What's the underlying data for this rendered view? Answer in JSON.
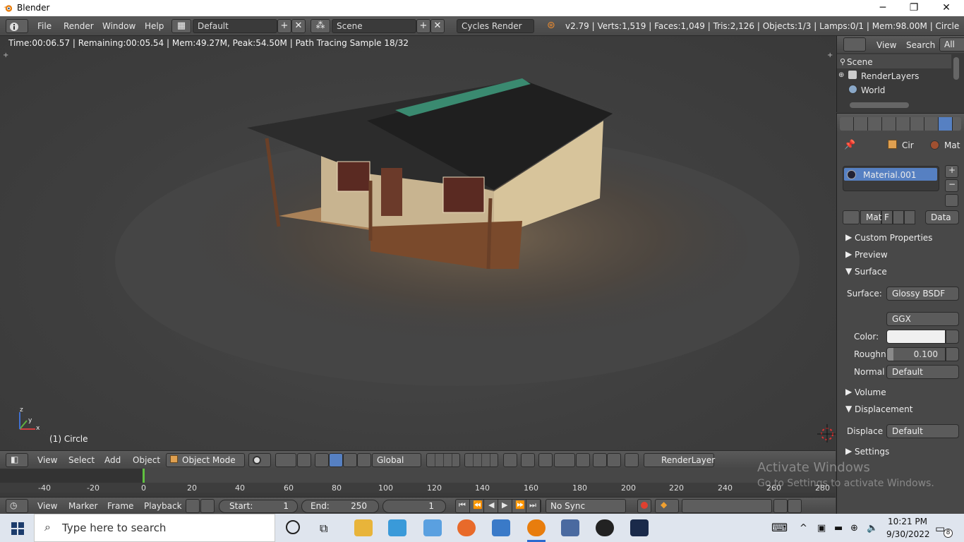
{
  "window": {
    "title": "Blender",
    "minimize": "─",
    "maximize": "❐",
    "close": "✕"
  },
  "info_header": {
    "menus": [
      "File",
      "Render",
      "Window",
      "Help"
    ],
    "screen_layout": "Default",
    "scene": "Scene",
    "render_engine": "Cycles Render",
    "stats": "v2.79 | Verts:1,519 | Faces:1,049 | Tris:2,126 | Objects:1/3 | Lamps:0/1 | Mem:98.00M | Circle"
  },
  "viewport": {
    "render_status": "Time:00:06.57 | Remaining:00:05.54 | Mem:49.27M, Peak:54.50M | Path Tracing Sample 18/32",
    "object_label": "(1) Circle",
    "axis": {
      "x": "x",
      "y": "y",
      "z": "z"
    },
    "header": {
      "menus": [
        "View",
        "Select",
        "Add",
        "Object"
      ],
      "mode": "Object Mode",
      "orientation": "Global",
      "render_layer": "RenderLayer"
    }
  },
  "timeline": {
    "ticks": [
      "-40",
      "-20",
      "0",
      "20",
      "40",
      "60",
      "80",
      "100",
      "120",
      "140",
      "160",
      "180",
      "200",
      "220",
      "240",
      "260",
      "280"
    ],
    "menus": [
      "View",
      "Marker",
      "Frame",
      "Playback"
    ],
    "start_label": "Start:",
    "start_value": "1",
    "end_label": "End:",
    "end_value": "250",
    "current_frame": "1",
    "sync": "No Sync"
  },
  "outliner": {
    "menus": [
      "View",
      "Search"
    ],
    "filter": "All Sc",
    "items": [
      "Scene",
      "RenderLayers",
      "World"
    ]
  },
  "properties": {
    "breadcrumb": {
      "object": "Cir",
      "material": "Mat"
    },
    "material_slot": "Material.001",
    "material_name": "Mat",
    "fake_user": "F",
    "link": "Data",
    "panels": {
      "custom_properties": "Custom Properties",
      "preview": "Preview",
      "surface": "Surface",
      "volume": "Volume",
      "displacement": "Displacement",
      "settings": "Settings"
    },
    "surface_label": "Surface:",
    "surface_value": "Glossy BSDF",
    "distribution": "GGX",
    "color_label": "Color:",
    "roughness_label": "Roughn",
    "roughness_value": "0.100",
    "normal_label": "Normal",
    "normal_value": "Default",
    "displace_label": "Displace",
    "displace_value": "Default"
  },
  "watermark": {
    "title": "Activate Windows",
    "subtitle": "Go to Settings to activate Windows."
  },
  "taskbar": {
    "search_placeholder": "Type here to search",
    "time": "10:21 PM",
    "date": "9/30/2022",
    "notifications": "8"
  },
  "colors": {
    "selection": "#5680c2",
    "timeline_marker": "#60c040",
    "accent_orange": "#e88a30"
  }
}
